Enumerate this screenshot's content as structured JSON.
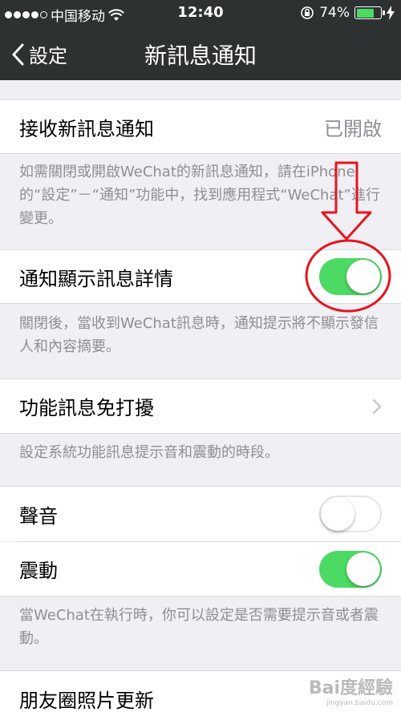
{
  "status_bar": {
    "carrier": "中国移动",
    "time": "12:40",
    "battery_percent": "74%",
    "battery_level": 0.74,
    "battery_color": "#4cd964"
  },
  "nav": {
    "back_label": "設定",
    "title": "新訊息通知"
  },
  "settings": {
    "receive": {
      "label": "接收新訊息通知",
      "value": "已開啟"
    },
    "receive_note": "如需關閉或開啟WeChat的新訊息通知，請在iPhone的“設定”－“通知”功能中，找到應用程式“WeChat”進行變更。",
    "show_details": {
      "label": "通知顯示訊息詳情",
      "on": true
    },
    "show_details_note": "關閉後，當收到WeChat訊息時，通知提示將不顯示發信人和內容摘要。",
    "dnd": {
      "label": "功能訊息免打擾"
    },
    "dnd_note": "設定系統功能訊息提示音和震動的時段。",
    "sound": {
      "label": "聲音",
      "on": false
    },
    "vibrate": {
      "label": "震動",
      "on": true
    },
    "sound_note": "當WeChat在執行時，你可以設定是否需要提示音或者震動。",
    "moments": {
      "label": "朋友圈照片更新"
    }
  },
  "colors": {
    "nav_background": "#2e3132",
    "toggle_on": "#4cd964",
    "annotation": "#e8141e"
  },
  "watermark": {
    "text": "Bai度經驗",
    "sub": "jingyan.baidu.com"
  }
}
